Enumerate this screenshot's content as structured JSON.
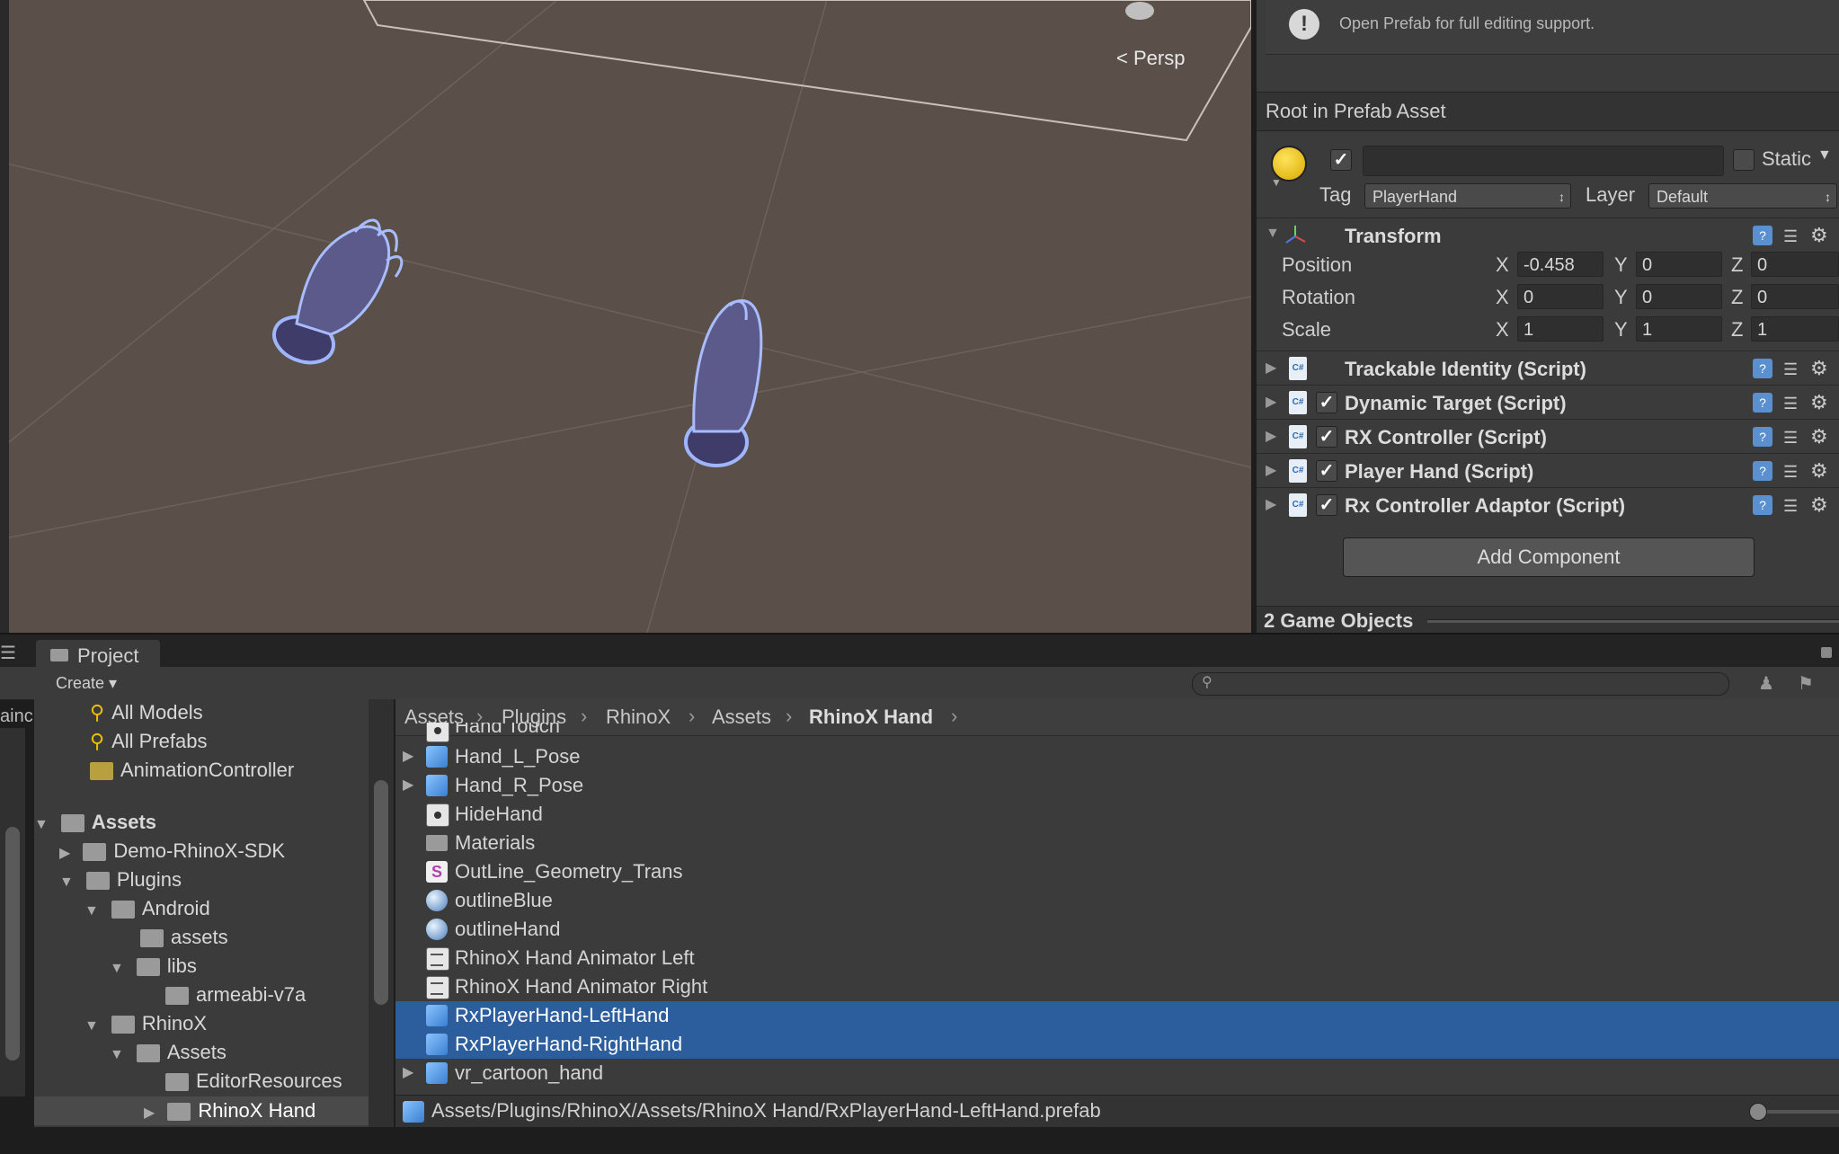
{
  "scene": {
    "projection_label": "Persp"
  },
  "inspector": {
    "notice": "Open Prefab for full editing support.",
    "root_header": "Root in Prefab Asset",
    "game_object": {
      "active": true,
      "name": "",
      "static_label": "Static",
      "tag_label": "Tag",
      "tag_value": "PlayerHand",
      "layer_label": "Layer",
      "layer_value": "Default"
    },
    "transform": {
      "title": "Transform",
      "rows": [
        {
          "label": "Position",
          "x": "-0.458",
          "y": "0",
          "z": "0"
        },
        {
          "label": "Rotation",
          "x": "0",
          "y": "0",
          "z": "0"
        },
        {
          "label": "Scale",
          "x": "1",
          "y": "1",
          "z": "1"
        }
      ],
      "axis_x": "X",
      "axis_y": "Y",
      "axis_z": "Z"
    },
    "components": [
      {
        "name": "Trackable Identity (Script)",
        "has_checkbox": false,
        "enabled": false
      },
      {
        "name": "Dynamic Target (Script)",
        "has_checkbox": true,
        "enabled": true
      },
      {
        "name": "RX Controller (Script)",
        "has_checkbox": true,
        "enabled": true
      },
      {
        "name": "Player Hand (Script)",
        "has_checkbox": true,
        "enabled": true
      },
      {
        "name": "Rx Controller Adaptor (Script)",
        "has_checkbox": true,
        "enabled": true
      }
    ],
    "add_component": "Add Component",
    "game_objects_count": "2 Game Objects"
  },
  "project": {
    "tab_label": "Project",
    "create_label": "Create",
    "search_placeholder": "",
    "left_edge_label": "ainc",
    "tree": [
      {
        "label": "All Models",
        "indent": 0,
        "type": "search"
      },
      {
        "label": "All Prefabs",
        "indent": 0,
        "type": "search"
      },
      {
        "label": "AnimationController",
        "indent": 0,
        "type": "star"
      },
      {
        "label": "Assets",
        "indent": 0,
        "type": "folder",
        "expanded": true,
        "bold": true
      },
      {
        "label": "Demo-RhinoX-SDK",
        "indent": 1,
        "type": "folder",
        "expanded": false
      },
      {
        "label": "Plugins",
        "indent": 1,
        "type": "folder",
        "expanded": true
      },
      {
        "label": "Android",
        "indent": 2,
        "type": "folder",
        "expanded": true
      },
      {
        "label": "assets",
        "indent": 3,
        "type": "folder"
      },
      {
        "label": "libs",
        "indent": 3,
        "type": "folder",
        "expanded": true
      },
      {
        "label": "armeabi-v7a",
        "indent": 4,
        "type": "folder"
      },
      {
        "label": "RhinoX",
        "indent": 2,
        "type": "folder",
        "expanded": true
      },
      {
        "label": "Assets",
        "indent": 3,
        "type": "folder",
        "expanded": true
      },
      {
        "label": "EditorResources",
        "indent": 4,
        "type": "folder"
      },
      {
        "label": "RhinoX Hand",
        "indent": 4,
        "type": "folder",
        "expanded": false,
        "selected": true
      }
    ],
    "breadcrumb": [
      "Assets",
      "Plugins",
      "RhinoX",
      "Assets",
      "RhinoX Hand"
    ],
    "files": [
      {
        "name": "Hand Touch",
        "icon": "dark",
        "partial": true
      },
      {
        "name": "Hand_L_Pose",
        "icon": "cube",
        "expandable": true
      },
      {
        "name": "Hand_R_Pose",
        "icon": "cube",
        "expandable": true
      },
      {
        "name": "HideHand",
        "icon": "dark"
      },
      {
        "name": "Materials",
        "icon": "folder"
      },
      {
        "name": "OutLine_Geometry_Trans",
        "icon": "shader"
      },
      {
        "name": "outlineBlue",
        "icon": "sphere"
      },
      {
        "name": "outlineHand",
        "icon": "sphere"
      },
      {
        "name": "RhinoX Hand Animator Left",
        "icon": "anim"
      },
      {
        "name": "RhinoX Hand Animator Right",
        "icon": "anim"
      },
      {
        "name": "RxPlayerHand-LeftHand",
        "icon": "cube",
        "selected": true
      },
      {
        "name": "RxPlayerHand-RightHand",
        "icon": "cube",
        "selected": true
      },
      {
        "name": "vr_cartoon_hand",
        "icon": "cube",
        "expandable": true
      }
    ],
    "status_path": "Assets/Plugins/RhinoX/Assets/RhinoX Hand/RxPlayerHand-LeftHand.prefab"
  },
  "colors": {
    "scene_bg": "#5a5049",
    "selection": "#2c5d9c",
    "panel": "#3b3b3b"
  }
}
